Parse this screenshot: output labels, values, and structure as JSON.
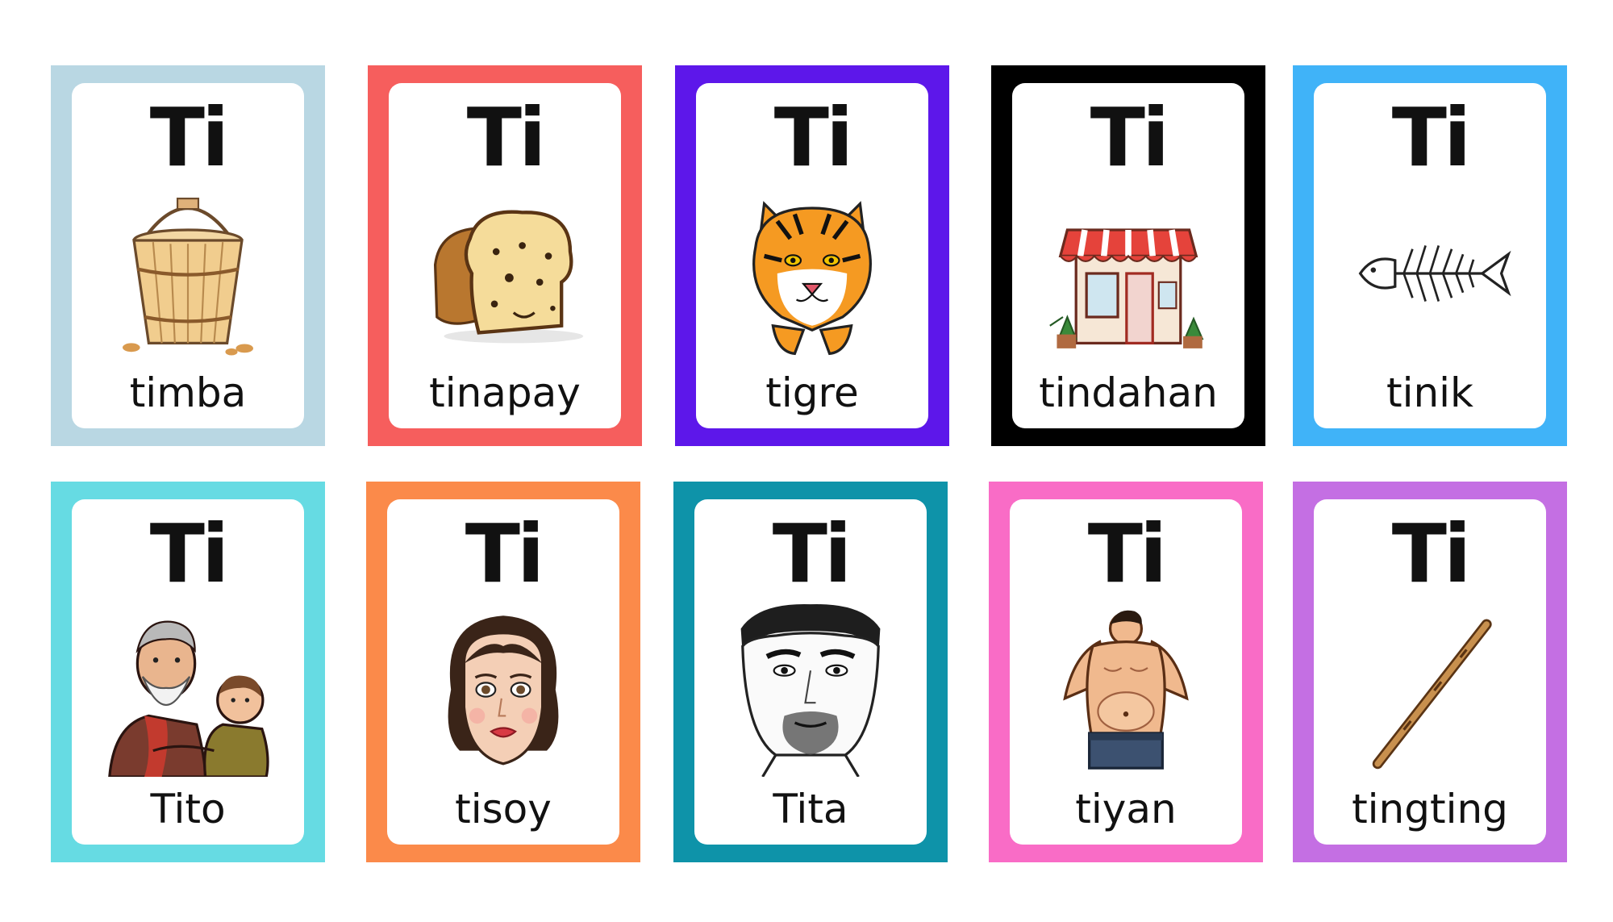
{
  "cards": [
    {
      "syllable": "Ti",
      "word": "timba",
      "border": "#b9d7e3",
      "picture": "bucket-icon"
    },
    {
      "syllable": "Ti",
      "word": "tinapay",
      "border": "#f65e5d",
      "picture": "bread-icon"
    },
    {
      "syllable": "Ti",
      "word": "tigre",
      "border": "#5d17ea",
      "picture": "tiger-icon"
    },
    {
      "syllable": "Ti",
      "word": "tindahan",
      "border": "#000000",
      "picture": "store-icon"
    },
    {
      "syllable": "Ti",
      "word": "tinik",
      "border": "#40b3f8",
      "picture": "fishbone-icon"
    },
    {
      "syllable": "Ti",
      "word": "Tito",
      "border": "#66dbe3",
      "picture": "uncle-icon"
    },
    {
      "syllable": "Ti",
      "word": "tisoy",
      "border": "#fb8a4a",
      "picture": "woman-face-icon"
    },
    {
      "syllable": "Ti",
      "word": "Tita",
      "border": "#0e93a9",
      "picture": "man-face-icon"
    },
    {
      "syllable": "Ti",
      "word": "tiyan",
      "border": "#f96cc6",
      "picture": "belly-icon"
    },
    {
      "syllable": "Ti",
      "word": "tingting",
      "border": "#c46fe3",
      "picture": "stick-icon"
    }
  ]
}
